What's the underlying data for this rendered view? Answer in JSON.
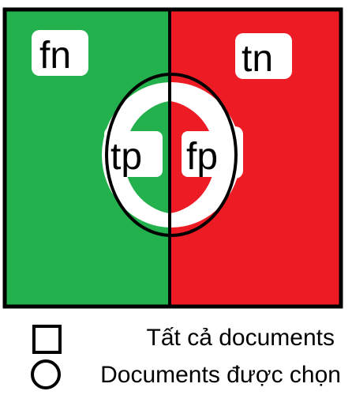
{
  "colors": {
    "negative_region": "#22b14c",
    "positive_region": "#ed1c24",
    "outline": "#000000",
    "label_halo": "#ffffff"
  },
  "regions": {
    "false_negative": "fn",
    "true_negative": "tn",
    "true_positive": "tp",
    "false_positive": "fp"
  },
  "legend": {
    "square_shape": "square",
    "square_label": "Tất cả documents",
    "circle_shape": "circle",
    "circle_label": "Documents được chọn"
  }
}
